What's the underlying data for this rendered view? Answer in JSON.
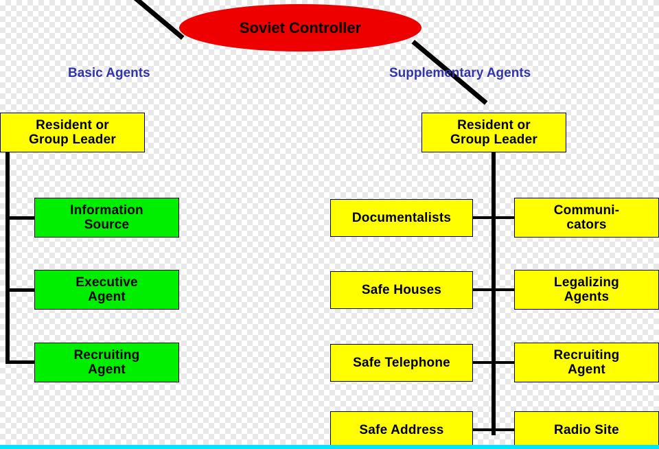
{
  "diagram": {
    "title": "Soviet Controller",
    "root": {
      "label": "Soviet Controller",
      "shape": "ellipse",
      "fill": "#ee0000",
      "text_color": "#000000"
    },
    "branch_labels": [
      {
        "label": "Basic Agents",
        "color": "#3333aa"
      },
      {
        "label": "Supplementary Agents",
        "color": "#3333aa"
      }
    ],
    "left_branch": {
      "head": {
        "label_line1": "Resident or",
        "label_line2": "Group Leader",
        "fill": "#ffff00"
      },
      "nodes": [
        {
          "label_line1": "Information",
          "label_line2": "Source",
          "fill": "#00ee00"
        },
        {
          "label_line1": "Executive",
          "label_line2": "Agent",
          "fill": "#00ee00"
        },
        {
          "label_line1": "Recruiting",
          "label_line2": "Agent",
          "fill": "#00ee00"
        }
      ]
    },
    "right_branch": {
      "head": {
        "label_line1": "Resident or",
        "label_line2": "Group Leader",
        "fill": "#ffff00"
      },
      "left_column": [
        {
          "label_line1": "Documentalists",
          "label_line2": "",
          "fill": "#ffff00"
        },
        {
          "label_line1": "Safe Houses",
          "label_line2": "",
          "fill": "#ffff00"
        },
        {
          "label_line1": "Safe Telephone",
          "label_line2": "",
          "fill": "#ffff00"
        },
        {
          "label_line1": "Safe Address",
          "label_line2": "",
          "fill": "#ffff00"
        }
      ],
      "right_column": [
        {
          "label_line1": "Communi-",
          "label_line2": "cators",
          "fill": "#ffff00"
        },
        {
          "label_line1": "Legalizing",
          "label_line2": "Agents",
          "fill": "#ffff00"
        },
        {
          "label_line1": "Recruiting",
          "label_line2": "Agent",
          "fill": "#ffff00"
        },
        {
          "label_line1": "Radio Site",
          "label_line2": "",
          "fill": "#ffff00"
        }
      ]
    },
    "accent_bar_color": "#00e5ff"
  }
}
